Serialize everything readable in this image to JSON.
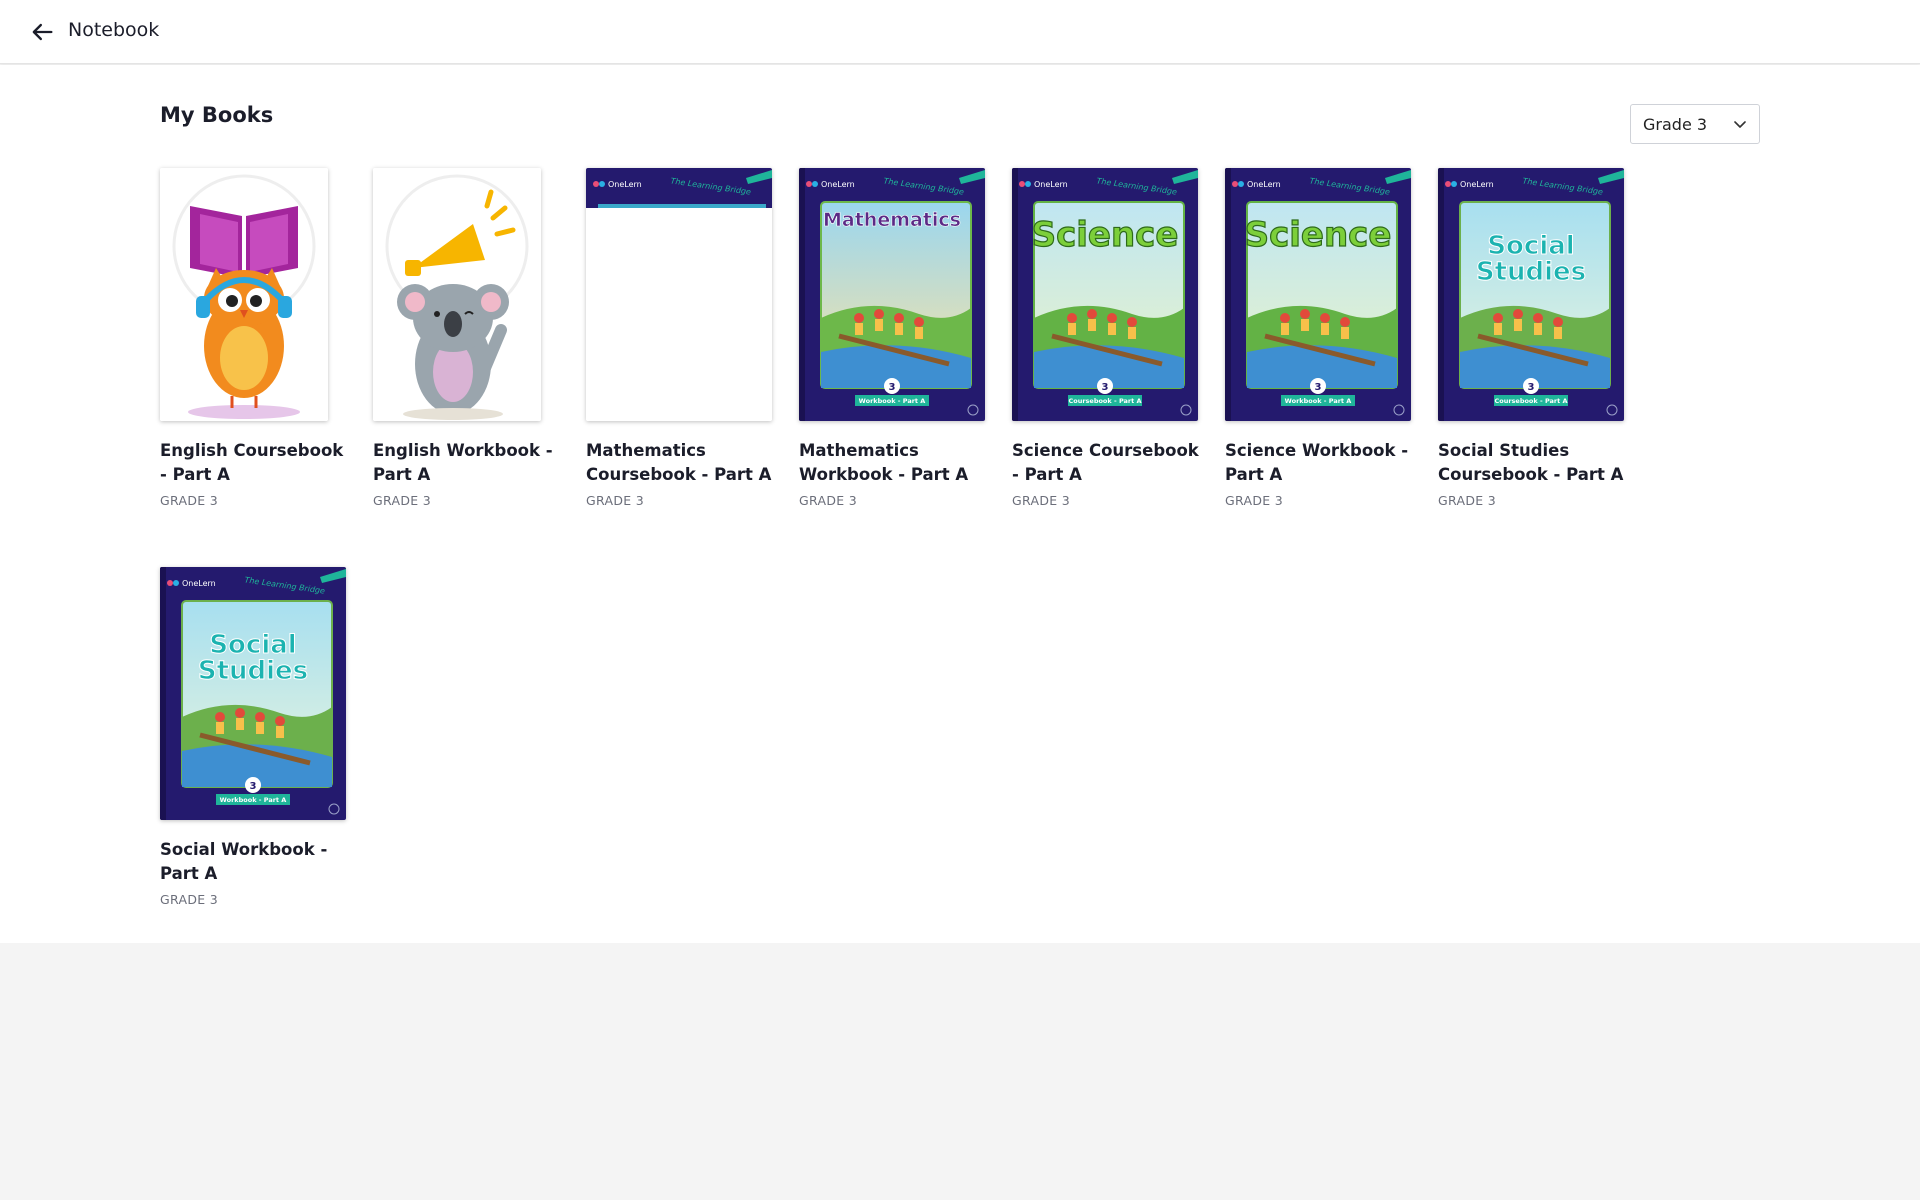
{
  "header": {
    "title": "Notebook",
    "back_icon": "arrow-left-icon"
  },
  "main": {
    "section_title": "My Books",
    "grade_filter": {
      "selected": "Grade 3"
    }
  },
  "books": [
    {
      "title": "English Coursebook - Part A",
      "grade": "GRADE 3",
      "cover": "owl-reading"
    },
    {
      "title": "English Workbook - Part A",
      "grade": "GRADE 3",
      "cover": "koala-megaphone"
    },
    {
      "title": "Mathematics Coursebook - Part A",
      "grade": "GRADE 3",
      "cover": "loading"
    },
    {
      "title": "Mathematics Workbook - Part A",
      "grade": "GRADE 3",
      "cover": "series",
      "cover_brand": "OneLern",
      "cover_series": "The Learning Bridge",
      "cover_subject": "Mathematics",
      "cover_grade_no": "3",
      "cover_part": "Workbook - Part A"
    },
    {
      "title": "Science Coursebook - Part A",
      "grade": "GRADE 3",
      "cover": "series",
      "cover_brand": "OneLern",
      "cover_series": "The Learning Bridge",
      "cover_subject": "Science",
      "cover_grade_no": "3",
      "cover_part": "Coursebook - Part A"
    },
    {
      "title": "Science Workbook - Part A",
      "grade": "GRADE 3",
      "cover": "series",
      "cover_brand": "OneLern",
      "cover_series": "The Learning Bridge",
      "cover_subject": "Science",
      "cover_grade_no": "3",
      "cover_part": "Workbook - Part A"
    },
    {
      "title": "Social Studies Coursebook - Part A",
      "grade": "GRADE 3",
      "cover": "series",
      "cover_brand": "OneLern",
      "cover_series": "The Learning Bridge",
      "cover_subject": "Social Studies",
      "cover_grade_no": "3",
      "cover_part": "Coursebook - Part A"
    },
    {
      "title": "Social Workbook - Part A",
      "grade": "GRADE 3",
      "cover": "series",
      "cover_brand": "OneLern",
      "cover_series": "The Learning Bridge",
      "cover_subject": "Social Studies",
      "cover_grade_no": "3",
      "cover_part": "Workbook - Part A"
    }
  ],
  "colors": {
    "cover_navy": "#241a6e",
    "cover_teal": "#1fb59a",
    "accent_purple": "#a3259c"
  }
}
